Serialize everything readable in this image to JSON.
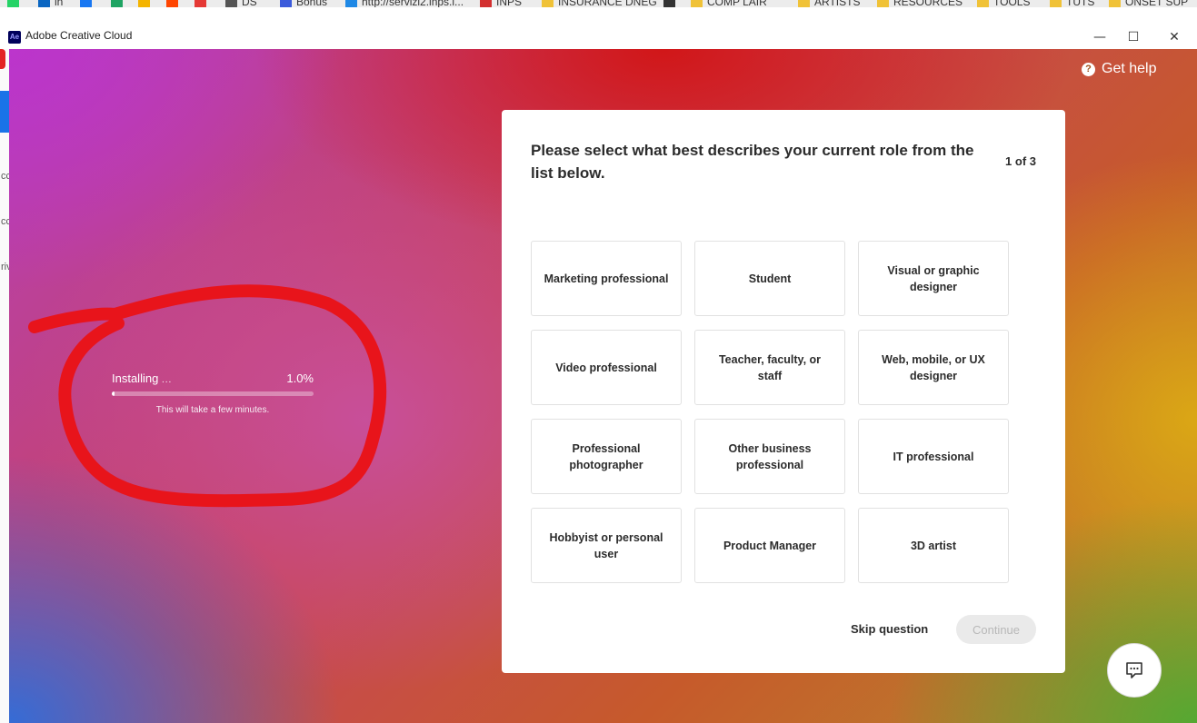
{
  "bookmarks": {
    "items": [
      {
        "label": "",
        "icon": "whatsapp-icon",
        "color": "#25d366"
      },
      {
        "label": "in",
        "icon": "linkedin-icon",
        "color": "#0a66c2"
      },
      {
        "label": "",
        "icon": "facebook-icon",
        "color": "#1877f2"
      },
      {
        "label": "",
        "icon": "google-drive-icon",
        "color": "#1fa463"
      },
      {
        "label": "",
        "icon": "keep-icon",
        "color": "#f4b400"
      },
      {
        "label": "",
        "icon": "reddit-icon",
        "color": "#ff4500"
      },
      {
        "label": "",
        "icon": "extension-icon",
        "color": "#e53935"
      },
      {
        "label": "DS",
        "icon": "ds-icon",
        "color": "#555555"
      },
      {
        "label": "Bonus",
        "icon": "bonus-icon",
        "color": "#3b5bdb"
      },
      {
        "label": "http://servizi2.inps.i...",
        "icon": "inps-icon",
        "color": "#1e88e5"
      },
      {
        "label": "INPS",
        "icon": "inps-logo-icon",
        "color": "#d32f2f"
      },
      {
        "label": "INSURANCE DNEG",
        "icon": "folder-icon",
        "color": "#f0c237"
      },
      {
        "label": "",
        "icon": "wix-icon",
        "color": "#333333"
      },
      {
        "label": "COMP LAIR",
        "icon": "folder-icon",
        "color": "#f0c237"
      },
      {
        "label": "ARTISTS",
        "icon": "folder-icon",
        "color": "#f0c237"
      },
      {
        "label": "RESOURCES",
        "icon": "folder-icon",
        "color": "#f0c237"
      },
      {
        "label": "TOOLS",
        "icon": "folder-icon",
        "color": "#f0c237"
      },
      {
        "label": "TUTS",
        "icon": "folder-icon",
        "color": "#f0c237"
      },
      {
        "label": "ONSET SUP",
        "icon": "folder-icon",
        "color": "#f0c237"
      }
    ]
  },
  "window": {
    "title": "Adobe Creative Cloud",
    "app_icon_text": "Ae",
    "minimize": "—",
    "maximize": "☐",
    "close": "✕"
  },
  "sliver": [
    "cc",
    "cc",
    "riv"
  ],
  "help": {
    "label": "Get help",
    "icon": "question-icon"
  },
  "install": {
    "label": "Installing",
    "dots": "...",
    "percent": "1.0%",
    "progress": 0.01,
    "note": "This will take a few minutes."
  },
  "survey": {
    "question": "Please select what best describes your current role from the list below.",
    "step": "1 of 3",
    "options": [
      "Marketing professional",
      "Student",
      "Visual or graphic designer",
      "Video professional",
      "Teacher, faculty, or staff",
      "Web, mobile, or UX designer",
      "Professional photographer",
      "Other business professional",
      "IT professional",
      "Hobbyist or personal user",
      "Product Manager",
      "3D artist"
    ],
    "skip_label": "Skip question",
    "continue_label": "Continue"
  },
  "colors": {
    "annotation_red": "#e8141b",
    "continue_disabled_bg": "#eaeaea",
    "continue_disabled_text": "#b8b8b8"
  }
}
